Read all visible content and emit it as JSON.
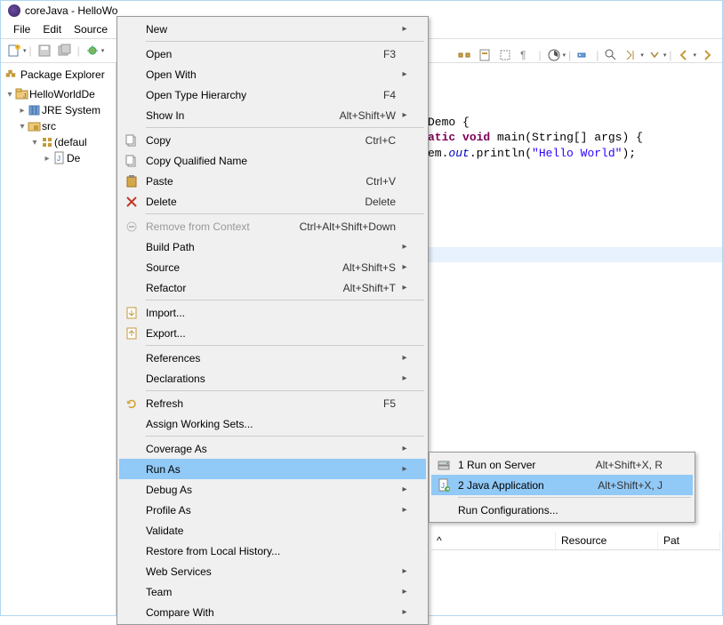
{
  "window": {
    "title": "coreJava - HelloWo"
  },
  "menubar": [
    "File",
    "Edit",
    "Source"
  ],
  "sidebar": {
    "header": "Package Explorer",
    "tree": {
      "project": "HelloWorldDe",
      "jre": "JRE System",
      "src": "src",
      "pkg": "(defaul",
      "file": "De"
    }
  },
  "code": {
    "line1a": "Demo {",
    "line2a": "atic",
    "line2b": "void",
    "line2c": " main(String[] args) {",
    "line3pre": "em.",
    "line3out": "out",
    "line3mid": ".println(",
    "line3str": "\"Hello World\"",
    "line3end": ");"
  },
  "ctx": [
    {
      "label": "New",
      "sub": true
    },
    {
      "sep": true
    },
    {
      "label": "Open",
      "shortcut": "F3"
    },
    {
      "label": "Open With",
      "sub": true
    },
    {
      "label": "Open Type Hierarchy",
      "shortcut": "F4"
    },
    {
      "label": "Show In",
      "shortcut": "Alt+Shift+W",
      "sub": true
    },
    {
      "sep": true
    },
    {
      "label": "Copy",
      "shortcut": "Ctrl+C",
      "icon": "copy"
    },
    {
      "label": "Copy Qualified Name",
      "icon": "copyq"
    },
    {
      "label": "Paste",
      "shortcut": "Ctrl+V",
      "icon": "paste"
    },
    {
      "label": "Delete",
      "shortcut": "Delete",
      "icon": "delete"
    },
    {
      "sep": true
    },
    {
      "label": "Remove from Context",
      "shortcut": "Ctrl+Alt+Shift+Down",
      "disabled": true,
      "icon": "remove"
    },
    {
      "label": "Build Path",
      "sub": true
    },
    {
      "label": "Source",
      "shortcut": "Alt+Shift+S",
      "sub": true
    },
    {
      "label": "Refactor",
      "shortcut": "Alt+Shift+T",
      "sub": true
    },
    {
      "sep": true
    },
    {
      "label": "Import...",
      "icon": "import"
    },
    {
      "label": "Export...",
      "icon": "export"
    },
    {
      "sep": true
    },
    {
      "label": "References",
      "sub": true
    },
    {
      "label": "Declarations",
      "sub": true
    },
    {
      "sep": true
    },
    {
      "label": "Refresh",
      "shortcut": "F5",
      "icon": "refresh"
    },
    {
      "label": "Assign Working Sets..."
    },
    {
      "sep": true
    },
    {
      "label": "Coverage As",
      "sub": true
    },
    {
      "label": "Run As",
      "sub": true,
      "selected": true
    },
    {
      "label": "Debug As",
      "sub": true
    },
    {
      "label": "Profile As",
      "sub": true
    },
    {
      "label": "Validate"
    },
    {
      "label": "Restore from Local History..."
    },
    {
      "label": "Web Services",
      "sub": true
    },
    {
      "label": "Team",
      "sub": true
    },
    {
      "label": "Compare With",
      "sub": true
    }
  ],
  "submenu": [
    {
      "label": "1 Run on Server",
      "shortcut": "Alt+Shift+X, R",
      "icon": "server"
    },
    {
      "label": "2 Java Application",
      "shortcut": "Alt+Shift+X, J",
      "icon": "java",
      "selected": true
    },
    {
      "sep": true
    },
    {
      "label": "Run Configurations..."
    }
  ],
  "table": {
    "cols": [
      "",
      "Resource",
      "Pat"
    ],
    "sortcol": "^"
  }
}
